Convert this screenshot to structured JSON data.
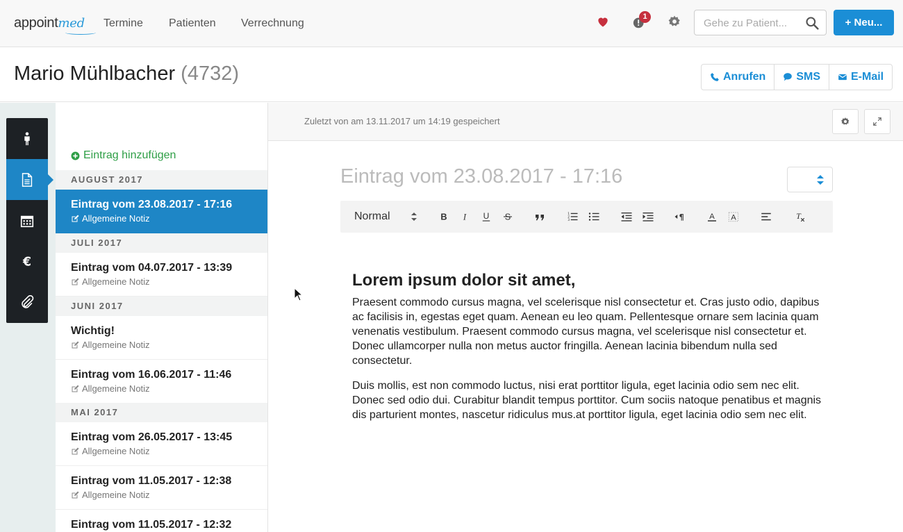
{
  "nav": {
    "logo_main": "appoint",
    "logo_accent": "med",
    "links": [
      "Termine",
      "Patienten",
      "Verrechnung"
    ],
    "notification_count": "1",
    "search_placeholder": "Gehe zu Patient...",
    "new_button": "Neu..."
  },
  "patient": {
    "name": "Mario Mühlbacher",
    "id": "(4732)",
    "actions": {
      "call": "Anrufen",
      "sms": "SMS",
      "email": "E-Mail"
    }
  },
  "rail": {
    "items": [
      "person-icon",
      "document-icon",
      "calendar-icon",
      "euro-icon",
      "paperclip-icon"
    ],
    "active": "document-icon"
  },
  "list": {
    "add_label": "Eintrag hinzufügen",
    "groups": [
      {
        "month": "AUGUST 2017",
        "entries": [
          {
            "title": "Eintrag vom 23.08.2017 - 17:16",
            "type": "Allgemeine Notiz",
            "active": true
          }
        ]
      },
      {
        "month": "JULI 2017",
        "entries": [
          {
            "title": "Eintrag vom 04.07.2017 - 13:39",
            "type": "Allgemeine Notiz"
          }
        ]
      },
      {
        "month": "JUNI 2017",
        "entries": [
          {
            "title": "Wichtig!",
            "type": "Allgemeine Notiz"
          },
          {
            "title": "Eintrag vom 16.06.2017 - 11:46",
            "type": "Allgemeine Notiz"
          }
        ]
      },
      {
        "month": "MAI 2017",
        "entries": [
          {
            "title": "Eintrag vom 26.05.2017 - 13:45",
            "type": "Allgemeine Notiz"
          },
          {
            "title": "Eintrag vom 11.05.2017 - 12:38",
            "type": "Allgemeine Notiz"
          },
          {
            "title": "Eintrag vom 11.05.2017 - 12:32",
            "type": ""
          }
        ]
      }
    ]
  },
  "editor": {
    "saved_text": "Zuletzt von am 13.11.2017 um 14:19 gespeichert",
    "title_placeholder": "Eintrag vom  23.08.2017 - 17:16",
    "format_select": "Normal",
    "heading": "Lorem ipsum dolor sit amet,",
    "paragraphs": [
      "Praesent commodo cursus magna, vel scelerisque nisl consectetur et. Cras justo odio, dapibus ac facilisis in, egestas eget quam. Aenean eu leo quam. Pellentesque ornare sem lacinia quam venenatis vestibulum. Praesent commodo cursus magna, vel scelerisque nisl consectetur et. Donec ullamcorper nulla non metus auctor fringilla. Aenean lacinia bibendum nulla sed consectetur.",
      "Duis mollis, est non commodo luctus, nisi erat porttitor ligula, eget lacinia odio sem nec elit. Donec sed odio dui. Curabitur blandit tempus porttitor. Cum sociis natoque penatibus et magnis dis parturient montes, nascetur ridiculus mus.at porttitor ligula, eget lacinia odio sem nec elit."
    ]
  },
  "colors": {
    "accent": "#1e86c6",
    "add_green": "#2e9e46",
    "badge_red": "#c6303e",
    "heart_red": "#c6303e"
  }
}
